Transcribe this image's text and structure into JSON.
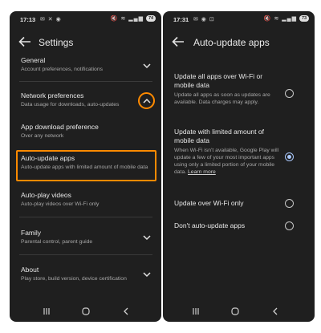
{
  "left": {
    "status": {
      "time": "17:13",
      "battery": "74"
    },
    "title": "Settings",
    "items": [
      {
        "title": "General",
        "subtitle": "Account preferences, notifications"
      },
      {
        "title": "Network preferences",
        "subtitle": "Data usage for downloads, auto-updates"
      },
      {
        "title": "App download preference",
        "subtitle": "Over any network"
      },
      {
        "title": "Auto-update apps",
        "subtitle": "Auto-update apps with limited amount of mobile data"
      },
      {
        "title": "Auto-play videos",
        "subtitle": "Auto-play videos over Wi-Fi only"
      },
      {
        "title": "Family",
        "subtitle": "Parental control, parent guide"
      },
      {
        "title": "About",
        "subtitle": "Play store, build version, device certification"
      }
    ]
  },
  "right": {
    "status": {
      "time": "17:31",
      "battery": "73"
    },
    "title": "Auto-update apps",
    "options": [
      {
        "title": "Update all apps over Wi-Fi or mobile data",
        "description": "Update all apps as soon as updates are available. Data charges may apply.",
        "selected": false
      },
      {
        "title": "Update with limited amount of mobile data",
        "description": "When Wi-Fi isn't available, Google Play will update a few of your most important apps using only a limited portion of your mobile data.",
        "link": "Learn more",
        "selected": true
      },
      {
        "title": "Update over Wi-Fi only",
        "description": "",
        "selected": false
      },
      {
        "title": "Don't auto-update apps",
        "description": "",
        "selected": false
      }
    ]
  },
  "colors": {
    "background": "#1f1f1f",
    "highlight": "#ff8a00",
    "radio_selected": "#a8c7fa"
  }
}
